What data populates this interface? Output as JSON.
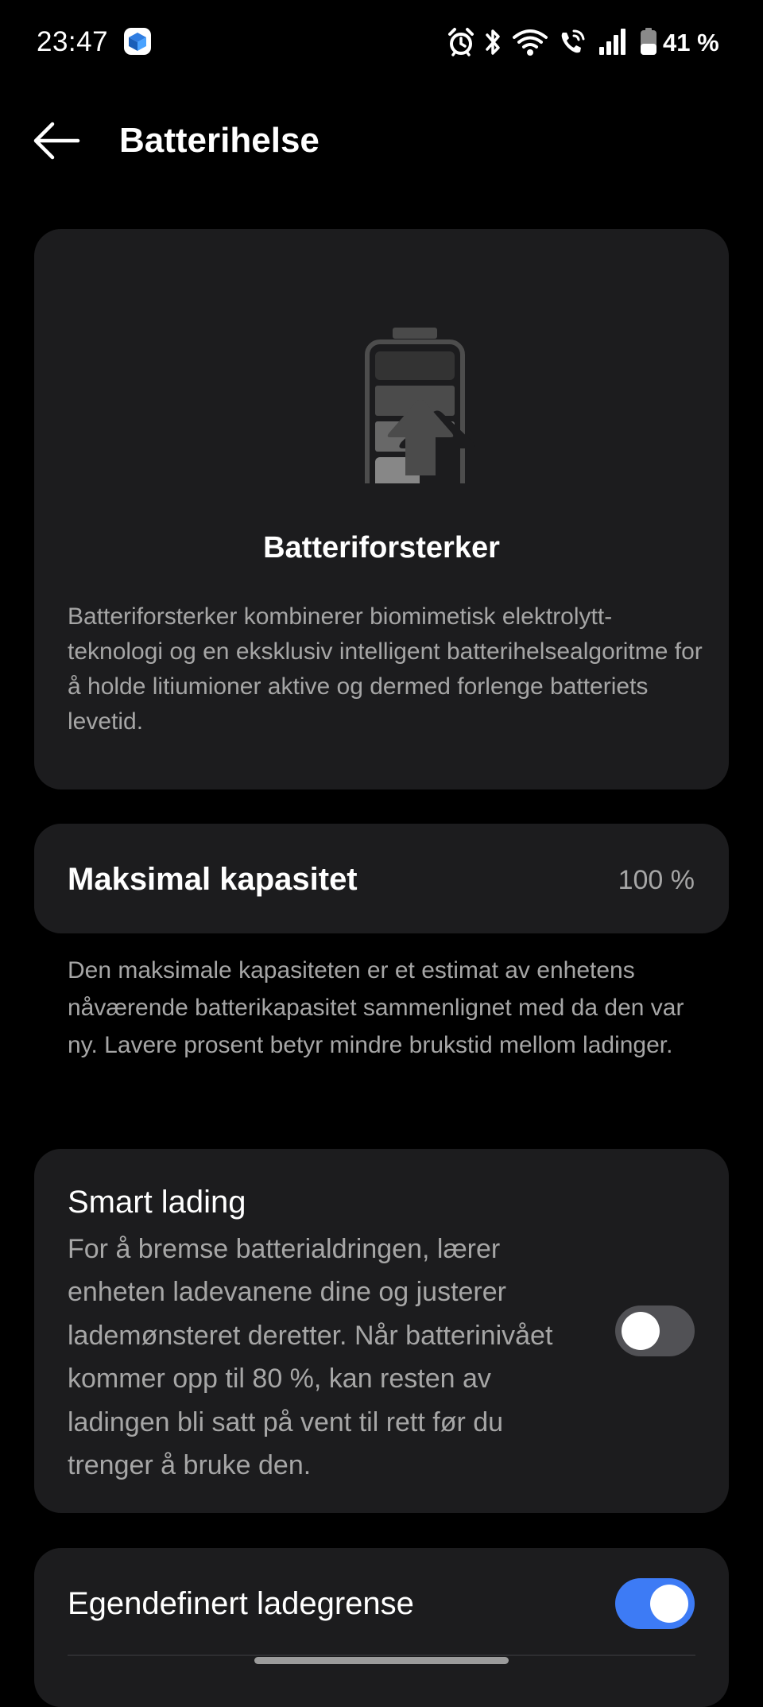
{
  "status_bar": {
    "time": "23:47",
    "battery_percent": "41 %",
    "icons": [
      "app-notification-icon",
      "alarm-icon",
      "bluetooth-icon",
      "wifi-icon",
      "wifi-calling-icon",
      "signal-icon",
      "battery-icon"
    ]
  },
  "header": {
    "title": "Batterihelse",
    "back_icon": "arrow-left-icon"
  },
  "battery_booster": {
    "illustration_icon": "battery-booster-icon",
    "title": "Batteriforsterker",
    "description": "Batteriforsterker kombinerer biomimetisk elektrolytt-teknologi og en eksklusiv intelligent batterihelsealgoritme for å holde litiumioner aktive og dermed forlenge batteriets levetid."
  },
  "max_capacity": {
    "label": "Maksimal kapasitet",
    "value": "100 %",
    "description": "Den maksimale kapasiteten er et estimat av enhetens nåværende batterikapasitet sammenlignet med da den var ny. Lavere prosent betyr mindre brukstid mellom ladinger."
  },
  "smart_charging": {
    "title": "Smart lading",
    "description": "For å bremse batterialdringen, lærer enheten ladevanene dine og justerer lademønsteret deretter. Når batterinivået kommer opp til 80 %, kan resten av ladingen bli satt på vent til rett før du trenger å bruke den.",
    "enabled": false
  },
  "custom_charge_limit": {
    "title": "Egendefinert ladegrense",
    "enabled": true
  },
  "colors": {
    "background": "#000000",
    "card": "#1c1c1e",
    "secondary_text": "#a6a6a6",
    "toggle_on": "#3d7bf5",
    "toggle_off": "#515155"
  }
}
